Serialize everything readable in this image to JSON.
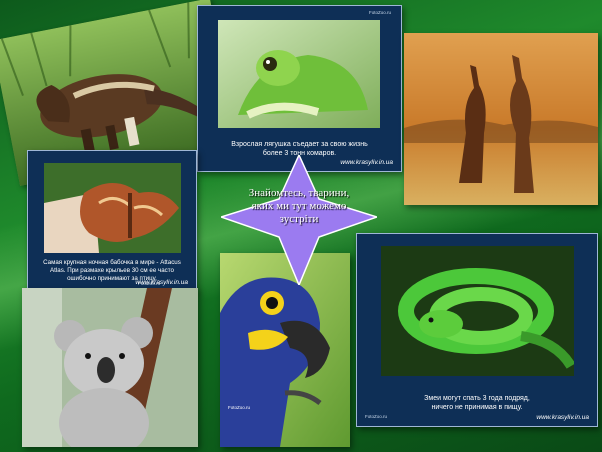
{
  "slide": {
    "center_text": "Знайомтесь, тварини, яких ми тут можемо зустріти"
  },
  "cards": {
    "frog": {
      "logo": "FotoZoo.ru",
      "caption": "Взрослая лягушка съедает за свою жизнь более 3 тонн комаров.",
      "site": "www.krasyliv.in.ua"
    },
    "moth": {
      "logo": "FotoZoo.ru",
      "caption": "Самая крупная ночная бабочка в мире - Attacus Atlas. При размахе крыльев 30 см ее часто ошибочно принимают за птицу.",
      "site": "www.krasyliv.in.ua"
    },
    "parrot": {
      "logo": "FotoZoo.ru"
    },
    "snake": {
      "logo": "FotoZoo.ru",
      "caption": "Змеи могут спать 3 года подряд, ничего не принимая в пищу.",
      "site": "www.krasyliv.in.ua"
    }
  },
  "colors": {
    "background": "#1f8a2c",
    "card_navy": "#0e2f56",
    "star_fill": "#9b7bf0"
  }
}
